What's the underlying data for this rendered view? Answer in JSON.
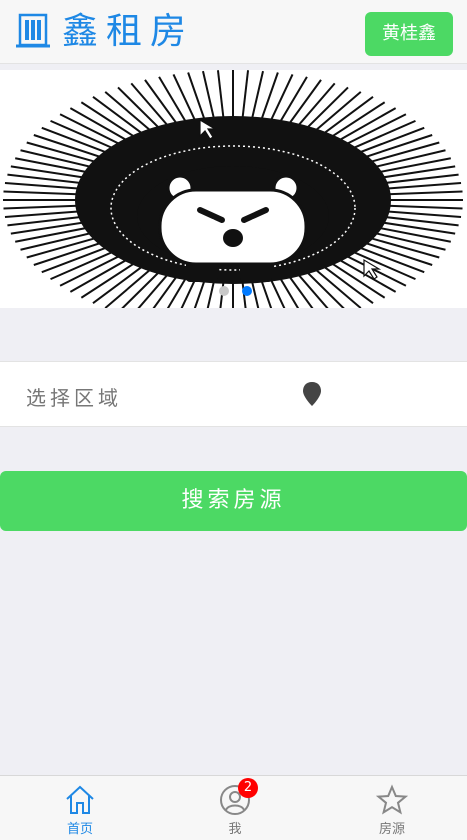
{
  "header": {
    "title": "鑫租房",
    "user_button": "黄桂鑫",
    "logo_icon": "building-icon",
    "accent": "#1e88e5"
  },
  "banner": {
    "image_icon": "hedgehog-illustration",
    "active_slide_index": 1,
    "slide_count": 2
  },
  "area": {
    "label": "选择区域",
    "icon": "location-pin-icon"
  },
  "search": {
    "label": "搜索房源",
    "color": "#4cd964"
  },
  "tabbar": {
    "items": [
      {
        "label": "首页",
        "icon": "home-icon",
        "active": true
      },
      {
        "label": "我",
        "icon": "user-icon",
        "badge": "2"
      },
      {
        "label": "房源",
        "icon": "star-icon"
      }
    ]
  }
}
